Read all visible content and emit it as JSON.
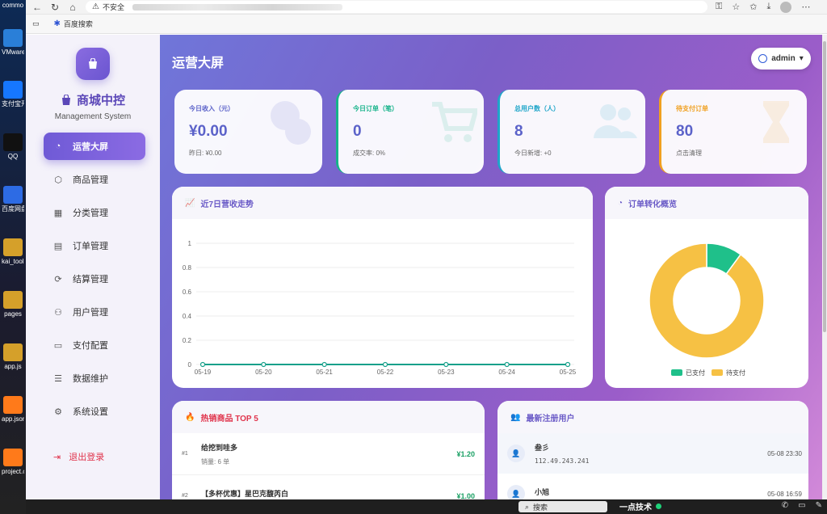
{
  "desktop": {
    "icons": [
      {
        "label": "commo",
        "color": "#222"
      },
      {
        "label": "VMware Workstat",
        "color": "#2a7fd8"
      },
      {
        "label": "支付宝开放 台密钥工",
        "color": "#1677ff"
      },
      {
        "label": "QQ",
        "color": "#111"
      },
      {
        "label": "百度网盘同 空间",
        "color": "#2d6be4"
      },
      {
        "label": "kai_tools",
        "color": "#d5a02a"
      },
      {
        "label": "pages",
        "color": "#d5a02a"
      },
      {
        "label": "app.js",
        "color": "#d5a02a"
      },
      {
        "label": "app.json",
        "color": "#ff7a1a"
      },
      {
        "label": "project.c",
        "color": "#ff7a1a"
      }
    ]
  },
  "browser": {
    "security_label": "不安全",
    "bookmark": "百度搜索"
  },
  "sidebar": {
    "brand": "商城中控",
    "brand_sub": "Management System",
    "items": [
      {
        "label": "运营大屏",
        "icon": "dashboard-icon",
        "glyph": "◔"
      },
      {
        "label": "商品管理",
        "icon": "box-icon",
        "glyph": "⬡"
      },
      {
        "label": "分类管理",
        "icon": "grid-icon",
        "glyph": "▦"
      },
      {
        "label": "订单管理",
        "icon": "list-icon",
        "glyph": "▤"
      },
      {
        "label": "结算管理",
        "icon": "settlement-icon",
        "glyph": "⟳"
      },
      {
        "label": "用户管理",
        "icon": "users-icon",
        "glyph": "⚇"
      },
      {
        "label": "支付配置",
        "icon": "card-icon",
        "glyph": "▭"
      },
      {
        "label": "数据维护",
        "icon": "server-icon",
        "glyph": "☰"
      },
      {
        "label": "系统设置",
        "icon": "gear-icon",
        "glyph": "⚙"
      }
    ],
    "logout": "退出登录"
  },
  "header": {
    "title": "运营大屏",
    "user": "admin"
  },
  "stats": [
    {
      "label": "今日收入（元）",
      "value": "¥0.00",
      "sub": "昨日: ¥0.00",
      "color": "#5b62c9"
    },
    {
      "label": "今日订单（笔）",
      "value": "0",
      "sub": "成交率: 0%",
      "color": "#16b38a"
    },
    {
      "label": "总用户数（人）",
      "value": "8",
      "sub": "今日新增: +0",
      "color": "#1ea5c9"
    },
    {
      "label": "待支付订单",
      "value": "80",
      "sub": "点击清理",
      "color": "#f0a020"
    }
  ],
  "revenue_card": {
    "title": "近7日营收走势"
  },
  "conversion_card": {
    "title": "订单转化概览"
  },
  "chart_data": [
    {
      "type": "line",
      "x": [
        "05-19",
        "05-20",
        "05-21",
        "05-22",
        "05-23",
        "05-24",
        "05-25"
      ],
      "series": [
        {
          "values": [
            0,
            0,
            0,
            0,
            0,
            0,
            0
          ],
          "color": "#16a08a"
        }
      ],
      "yticks": [
        "0",
        "0.2",
        "0.4",
        "0.6",
        "0.8",
        "1"
      ],
      "ylim": [
        0,
        1
      ],
      "grid": true
    },
    {
      "type": "pie",
      "donut": true,
      "slices": [
        {
          "label": "已支付",
          "value": 9,
          "color": "#1fc08a"
        },
        {
          "label": "待支付",
          "value": 80,
          "color": "#f6c144"
        }
      ],
      "legend": "bottom"
    }
  ],
  "top5": {
    "title": "热销商品 TOP 5",
    "items": [
      {
        "rank": "#1",
        "name": "给挖到哇多",
        "sales": "销量: 6 单",
        "price": "¥1.20"
      },
      {
        "rank": "#2",
        "name": "【多杯优惠】星巴克馥芮白",
        "sales": "",
        "price": "¥1.00"
      }
    ]
  },
  "new_users": {
    "title": "最新注册用户",
    "items": [
      {
        "name": "叁彡",
        "ip": "112.49.243.241",
        "time": "05-08 23:30"
      },
      {
        "name": "小旭",
        "ip": "",
        "time": "05-08 16:59"
      }
    ]
  },
  "taskbar": {
    "search": "搜索",
    "news": "一点技术"
  }
}
